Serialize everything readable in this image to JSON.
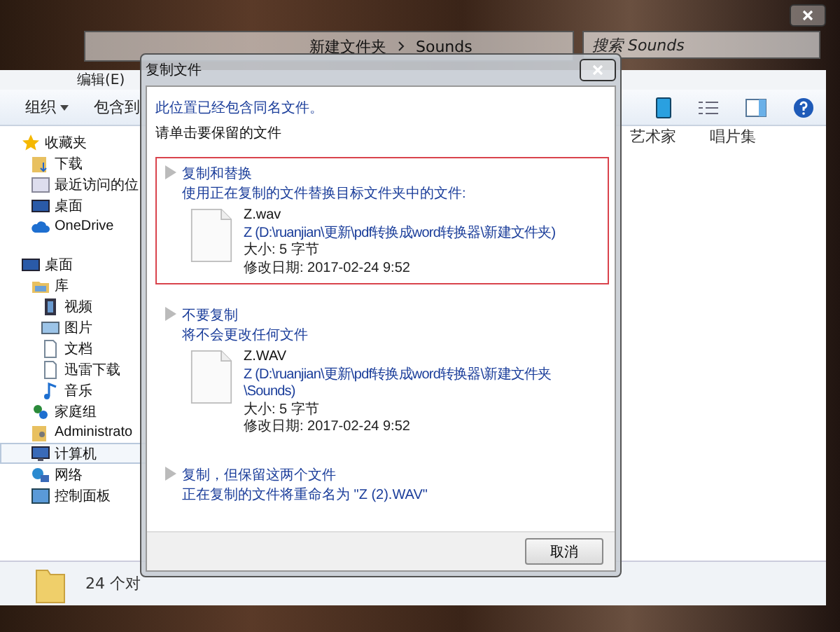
{
  "explorer": {
    "address_path": [
      "新建文件夹",
      "Sounds"
    ],
    "search": {
      "placeholder": "搜索 Sounds"
    },
    "menu": [
      "编辑(E)"
    ],
    "toolbar": [
      "组织",
      "包含到"
    ],
    "sidebar": [
      {
        "label": "收藏夹",
        "kind": "star",
        "selected": false,
        "children": [
          {
            "label": "下载",
            "kind": "download",
            "selected": false
          },
          {
            "label": "最近访问的位",
            "kind": "recent",
            "selected": false
          },
          {
            "label": "桌面",
            "kind": "monitor",
            "selected": false
          },
          {
            "label": "OneDrive",
            "kind": "cloud",
            "selected": false
          }
        ]
      },
      {
        "label": "桌面",
        "kind": "monitor",
        "selected": false,
        "children": [
          {
            "label": "库",
            "kind": "library",
            "selected": false,
            "children": [
              {
                "label": "视频",
                "kind": "video",
                "selected": false
              },
              {
                "label": "图片",
                "kind": "picture",
                "selected": false
              },
              {
                "label": "文档",
                "kind": "document",
                "selected": false
              },
              {
                "label": "迅雷下载",
                "kind": "document",
                "selected": false
              },
              {
                "label": "音乐",
                "kind": "music",
                "selected": false
              }
            ]
          },
          {
            "label": "家庭组",
            "kind": "homegroup",
            "selected": false
          },
          {
            "label": "Administrato",
            "kind": "user",
            "selected": false
          },
          {
            "label": "计算机",
            "kind": "computer",
            "selected": true
          },
          {
            "label": "网络",
            "kind": "network",
            "selected": false
          },
          {
            "label": "控制面板",
            "kind": "panel",
            "selected": false
          }
        ]
      }
    ],
    "columns": [
      "艺术家",
      "唱片集"
    ],
    "status": "24 个对"
  },
  "dialog": {
    "title": "复制文件",
    "message": "此位置已经包含同名文件。",
    "instruction": "请单击要保留的文件",
    "options": [
      {
        "title": "复制和替换",
        "description": "使用正在复制的文件替换目标文件夹中的文件:",
        "highlighted": true,
        "file": {
          "name": "Z.wav",
          "path": "Z (D:\\ruanjian\\更新\\pdf转换成word转换器\\新建文件夹)",
          "size": "大小: 5 字节",
          "modified": "修改日期: 2017-02-24 9:52"
        }
      },
      {
        "title": "不要复制",
        "description": "将不会更改任何文件",
        "highlighted": false,
        "file": {
          "name": "Z.WAV",
          "path": "Z (D:\\ruanjian\\更新\\pdf转换成word转换器\\新建文件夹\\Sounds)",
          "size": "大小: 5 字节",
          "modified": "修改日期: 2017-02-24 9:52"
        }
      },
      {
        "title": "复制，但保留这两个文件",
        "description": "正在复制的文件将重命名为 \"Z (2).WAV\"",
        "highlighted": false
      }
    ],
    "cancel": "取消"
  }
}
